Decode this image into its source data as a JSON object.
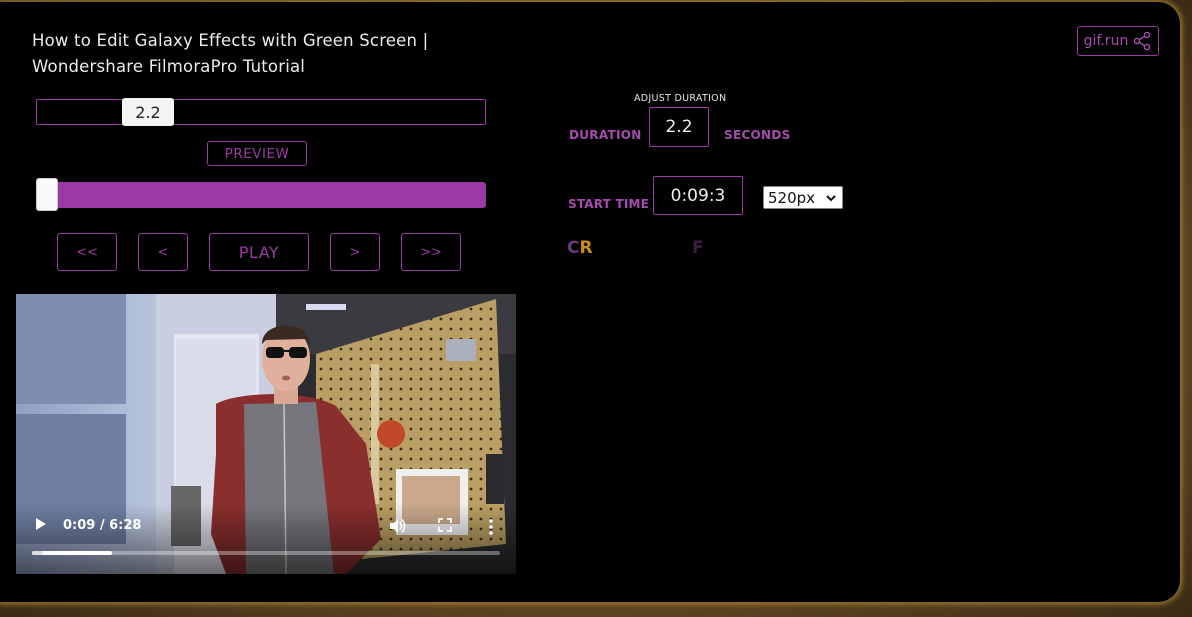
{
  "page": {
    "title": "How to Edit Galaxy Effects with Green Screen | Wondershare FilmoraPro Tutorial",
    "brand": "gif.run"
  },
  "editor": {
    "duration_slider_value": "2.2",
    "preview_label": "PREVIEW",
    "progress_fraction": 0.0,
    "controls": {
      "rewind_fast": "<<",
      "rewind": "<",
      "play": "PLAY",
      "forward": ">",
      "forward_fast": ">>"
    }
  },
  "video": {
    "time_display": "0:09 / 6:28",
    "played_fraction": 0.023,
    "buffered_fraction": 0.17
  },
  "settings": {
    "adjust_duration_label": "ADJUST DURATION",
    "duration_label": "DURATION",
    "duration_value": "2.2",
    "seconds_label": "SECONDS",
    "start_time_label": "START TIME",
    "start_time_value": "0:09:3",
    "size_option": "520px",
    "cr_c": "C",
    "cr_r": "R",
    "f_label": "F"
  },
  "colors": {
    "accent": "#9b3aa4",
    "accent_text": "#a64bb0",
    "cr_r": "#d08a1a",
    "frame": "#6b5527"
  }
}
